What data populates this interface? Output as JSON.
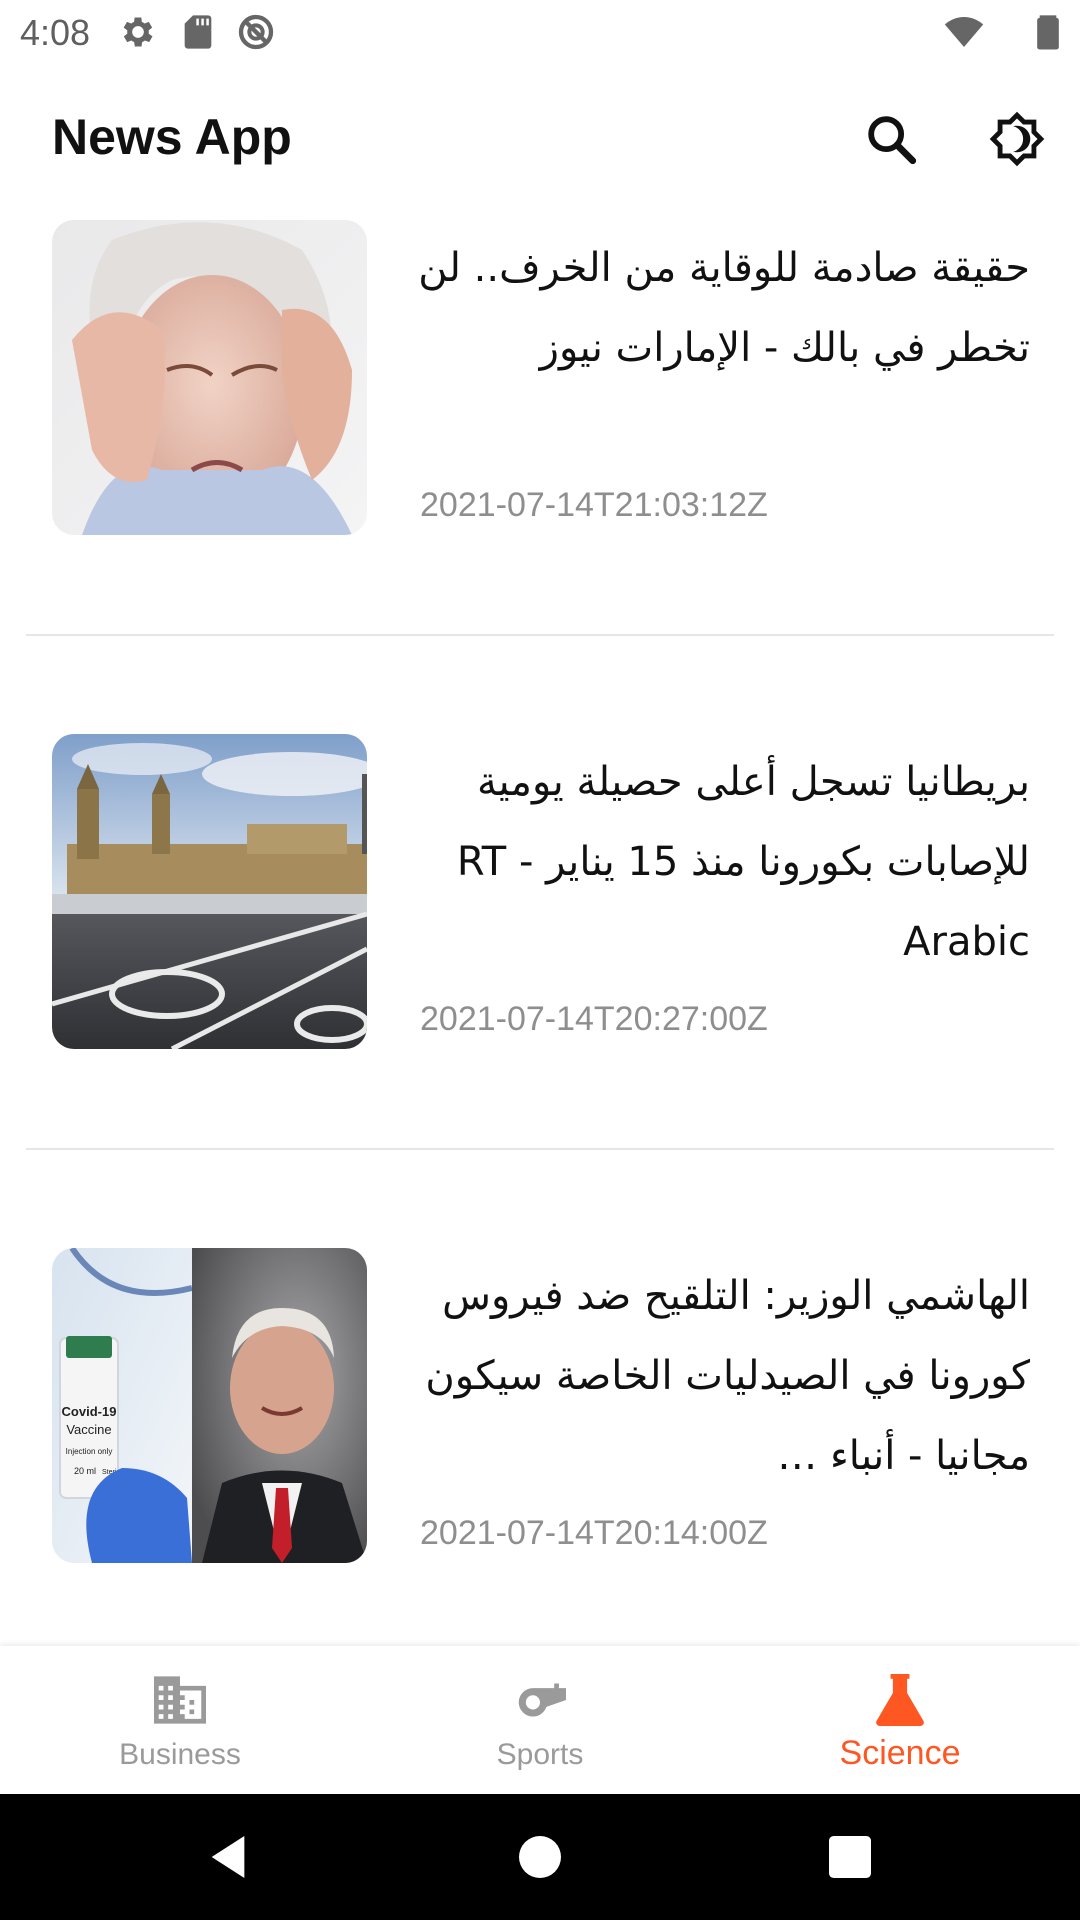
{
  "status_bar": {
    "time": "4:08",
    "left_icons": [
      "gear-icon",
      "sd-card-icon",
      "no-disturb-icon"
    ],
    "right_icons": [
      "wifi-icon",
      "battery-icon"
    ]
  },
  "app_bar": {
    "title": "News App",
    "actions": [
      "search-icon",
      "theme-toggle-icon"
    ]
  },
  "articles": [
    {
      "title": "حقيقة صادمة للوقاية من الخرف.. لن تخطر في بالك - الإمارات نيوز",
      "date": "2021-07-14T21:03:12Z"
    },
    {
      "title": "بريطانيا تسجل أعلى حصيلة يومية للإصابات بكورونا منذ 15 يناير - RT Arabic",
      "date": "2021-07-14T20:27:00Z"
    },
    {
      "title": "الهاشمي الوزير: التلقيح ضد فيروس كورونا في الصيدليات الخاصة سيكون مجانيا - أنباء …",
      "date": "2021-07-14T20:14:00Z",
      "image_text": {
        "line1": "Covid-19",
        "line2": "Vaccine",
        "line3": "Injection only",
        "line4": "20 ml",
        "line5": "Steri"
      }
    }
  ],
  "bottom_nav": {
    "items": [
      {
        "label": "Business",
        "icon": "building-icon",
        "active": false
      },
      {
        "label": "Sports",
        "icon": "whistle-icon",
        "active": false
      },
      {
        "label": "Science",
        "icon": "flask-icon",
        "active": true
      }
    ]
  },
  "colors": {
    "accent": "#ff5722",
    "inactive": "#9a9a9a",
    "date_text": "#8e8e8e",
    "divider": "#e6e6e6"
  },
  "system_nav": [
    "back-icon",
    "home-icon",
    "recents-icon"
  ]
}
